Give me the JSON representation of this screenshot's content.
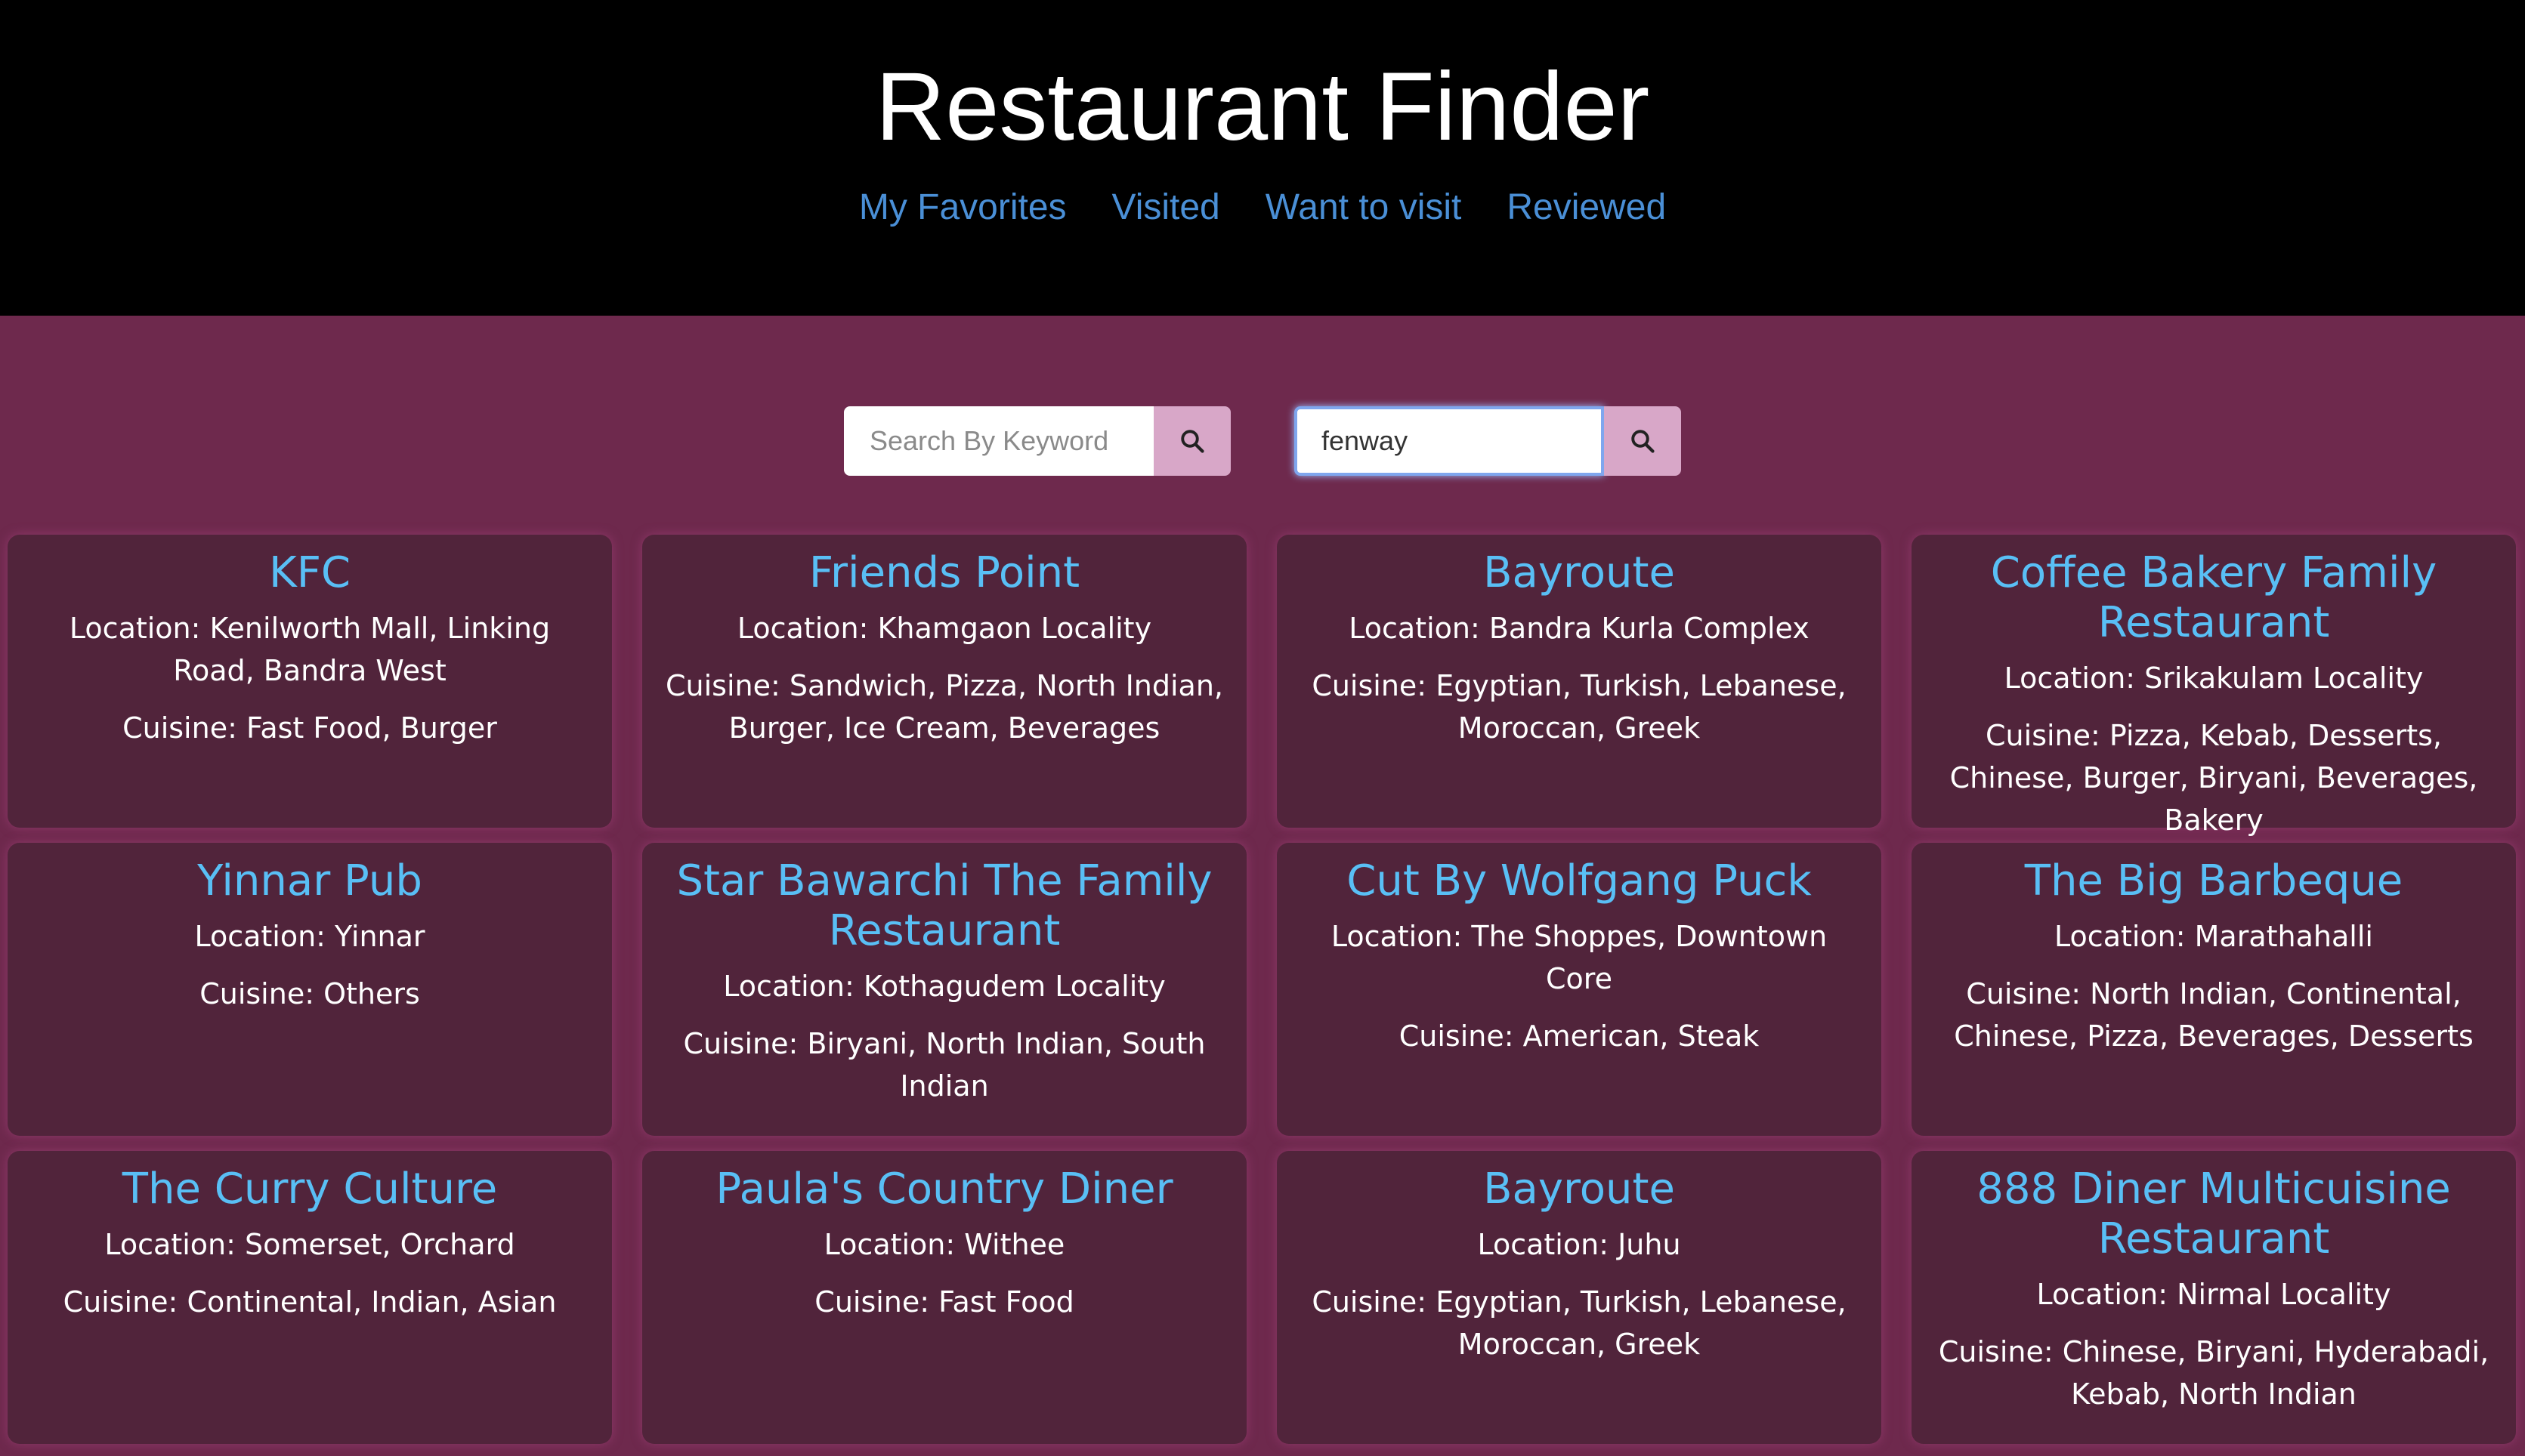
{
  "header": {
    "title": "Restaurant Finder",
    "nav": [
      "My Favorites",
      "Visited",
      "Want to visit",
      "Reviewed"
    ]
  },
  "search": {
    "keyword": {
      "placeholder": "Search By Keyword",
      "value": ""
    },
    "location": {
      "placeholder": "",
      "value": "fenway"
    }
  },
  "restaurants": [
    {
      "name": "KFC",
      "location": "Location: Kenilworth Mall, Linking Road, Bandra West",
      "cuisine": "Cuisine: Fast Food, Burger"
    },
    {
      "name": "Friends Point",
      "location": "Location: Khamgaon Locality",
      "cuisine": "Cuisine: Sandwich, Pizza, North Indian, Burger, Ice Cream, Beverages"
    },
    {
      "name": "Bayroute",
      "location": "Location: Bandra Kurla Complex",
      "cuisine": "Cuisine: Egyptian, Turkish, Lebanese, Moroccan, Greek"
    },
    {
      "name": "Coffee Bakery Family Restaurant",
      "location": "Location: Srikakulam Locality",
      "cuisine": "Cuisine: Pizza, Kebab, Desserts, Chinese, Burger, Biryani, Beverages, Bakery"
    },
    {
      "name": "Yinnar Pub",
      "location": "Location: Yinnar",
      "cuisine": "Cuisine: Others"
    },
    {
      "name": "Star Bawarchi The Family Restaurant",
      "location": "Location: Kothagudem Locality",
      "cuisine": "Cuisine: Biryani, North Indian, South Indian"
    },
    {
      "name": "Cut By Wolfgang Puck",
      "location": "Location: The Shoppes, Downtown Core",
      "cuisine": "Cuisine: American, Steak"
    },
    {
      "name": "The Big Barbeque",
      "location": "Location: Marathahalli",
      "cuisine": "Cuisine: North Indian, Continental, Chinese, Pizza, Beverages, Desserts"
    },
    {
      "name": "The Curry Culture",
      "location": "Location: Somerset, Orchard",
      "cuisine": "Cuisine: Continental, Indian, Asian"
    },
    {
      "name": "Paula's Country Diner",
      "location": "Location: Withee",
      "cuisine": "Cuisine: Fast Food"
    },
    {
      "name": "Bayroute",
      "location": "Location: Juhu",
      "cuisine": "Cuisine: Egyptian, Turkish, Lebanese, Moroccan, Greek"
    },
    {
      "name": "888 Diner Multicuisine Restaurant",
      "location": "Location: Nirmal Locality",
      "cuisine": "Cuisine: Chinese, Biryani, Hyderabadi, Kebab, North Indian"
    }
  ],
  "colors": {
    "header_bg": "#000000",
    "page_bg": "#6e294d",
    "card_bg": "#51243b",
    "name_color": "#59bff5",
    "nav_color": "#4a8fd6",
    "search_button_bg": "#d8a7c8"
  },
  "icons": {
    "search_button": "search-icon"
  }
}
